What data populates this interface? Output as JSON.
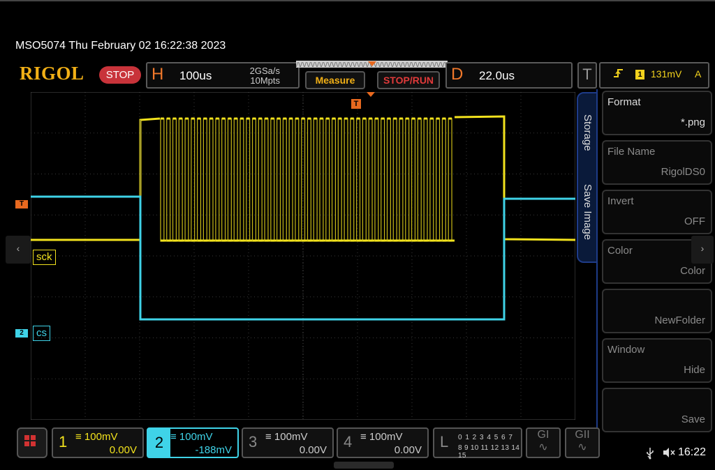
{
  "header": {
    "model_datetime": "MSO5074  Thu February 02 16:22:38 2023",
    "logo": "RIGOL",
    "run_state": "STOP"
  },
  "horizontal": {
    "letter": "H",
    "timebase": "100us",
    "sample_rate": "2GSa/s",
    "memory_depth": "10Mpts"
  },
  "buttons": {
    "measure": "Measure",
    "stop_run": "STOP/RUN"
  },
  "delay": {
    "letter": "D",
    "value": "22.0us"
  },
  "trigger": {
    "letter": "T",
    "source": "1",
    "level": "131mV",
    "mode": "A",
    "marker": "T"
  },
  "side_menu": {
    "tab_storage": "Storage",
    "tab_save_image": "Save Image",
    "items": [
      {
        "label": "Format",
        "value": "*.png"
      },
      {
        "label": "File Name",
        "value": "RigolDS0"
      },
      {
        "label": "Invert",
        "value": "OFF"
      },
      {
        "label": "Color",
        "value": "Color"
      },
      {
        "label": "",
        "value": "NewFolder"
      },
      {
        "label": "Window",
        "value": "Hide"
      },
      {
        "label": "",
        "value": "Save"
      }
    ]
  },
  "channel_labels": {
    "ch1": "sck",
    "ch2": "cs",
    "ch1_marker": "1",
    "ch2_marker": "2",
    "trigger_marker": "T"
  },
  "channels": [
    {
      "num": "1",
      "scale": "100mV",
      "offset": "0.00V",
      "color": "#f2e21d"
    },
    {
      "num": "2",
      "scale": "100mV",
      "offset": "-188mV",
      "color": "#3fd3e8"
    },
    {
      "num": "3",
      "scale": "100mV",
      "offset": "0.00V"
    },
    {
      "num": "4",
      "scale": "100mV",
      "offset": "0.00V"
    }
  ],
  "logic": {
    "letter": "L",
    "row1": "0 1 2 3  4 5 6 7",
    "row2": "8 9 10 11  12 13 14 15"
  },
  "generators": {
    "g1": "GI",
    "g2": "GII"
  },
  "status": {
    "time": "16:22"
  }
}
